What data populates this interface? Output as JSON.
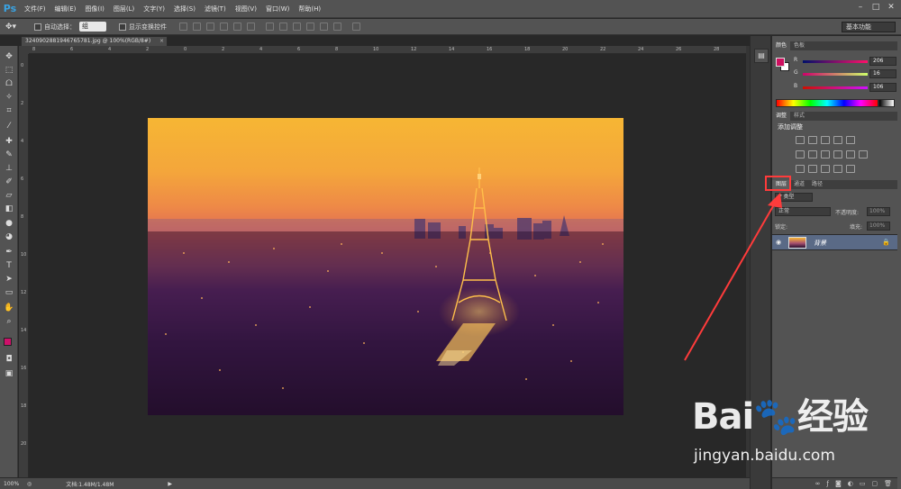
{
  "app": {
    "logo": "Ps"
  },
  "menu": [
    "文件(F)",
    "编辑(E)",
    "图像(I)",
    "图层(L)",
    "文字(Y)",
    "选择(S)",
    "滤镜(T)",
    "视图(V)",
    "窗口(W)",
    "帮助(H)"
  ],
  "window_controls": [
    "–",
    "□",
    "✕"
  ],
  "options_bar": {
    "auto_select_label": "自动选择：",
    "auto_select_value": "组",
    "show_transform_label": "显示变换控件",
    "workspace": "基本功能"
  },
  "document": {
    "tab_title": "3240902881946765781.jpg @ 100%(RGB/8#)",
    "close": "×",
    "zoom": "100%",
    "doc_info": "文档:1.48M/1.48M"
  },
  "ruler": {
    "h_labels": [
      "8",
      "6",
      "4",
      "2",
      "0",
      "2",
      "4",
      "6",
      "8",
      "10",
      "12",
      "14",
      "16",
      "18",
      "20",
      "22",
      "24",
      "26",
      "28"
    ],
    "v_labels": [
      "0",
      "2",
      "4",
      "6",
      "8",
      "10",
      "12",
      "14",
      "16",
      "18",
      "20"
    ]
  },
  "panels": {
    "color": {
      "tabs": [
        "颜色",
        "色板"
      ],
      "r_label": "R",
      "r_value": "206",
      "g_label": "G",
      "g_value": "16",
      "b_label": "B",
      "b_value": "106",
      "fg_color": "#ce106a"
    },
    "adjustments": {
      "tabs": [
        "调整",
        "样式"
      ],
      "title": "添加调整"
    },
    "layers": {
      "tabs": [
        "图层",
        "通道",
        "路径"
      ],
      "kind_filter": "P 类型",
      "blend_mode": "正常",
      "opacity_label": "不透明度:",
      "opacity_value": "100%",
      "lock_label": "锁定:",
      "fill_label": "填充:",
      "fill_value": "100%",
      "layer_name": "背景"
    }
  },
  "watermark": {
    "logo": "Bai🐾经验",
    "url": "jingyan.baidu.com"
  },
  "annotation_color": "#ff3b3b"
}
